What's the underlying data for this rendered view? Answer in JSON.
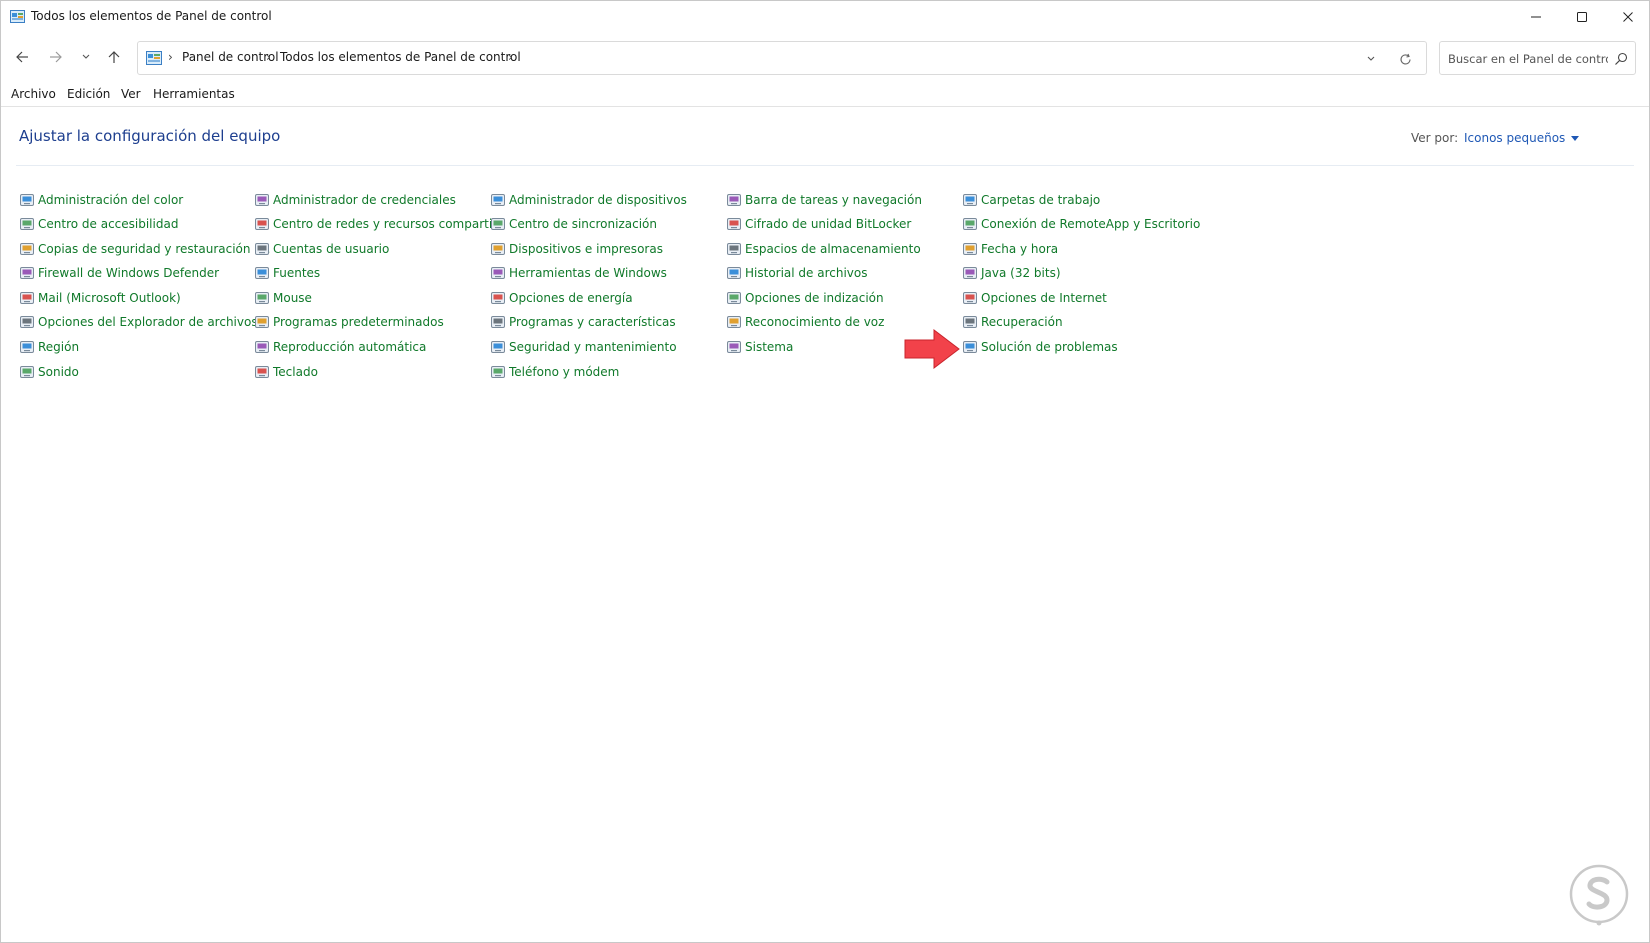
{
  "window": {
    "title": "Todos los elementos de Panel de control",
    "controls": {
      "minimize": "minimize-icon",
      "maximize": "maximize-icon",
      "close": "close-icon"
    }
  },
  "nav": {
    "back": "arrow-left-icon",
    "forward": "arrow-right-icon",
    "recent": "chevron-down-icon",
    "up": "arrow-up-icon"
  },
  "address": {
    "crumbs": [
      "Panel de control",
      "Todos los elementos de Panel de control"
    ],
    "separator": "›"
  },
  "search": {
    "placeholder": "Buscar en el Panel de control"
  },
  "menu": {
    "items": [
      "Archivo",
      "Edición",
      "Ver",
      "Herramientas"
    ]
  },
  "header": {
    "title": "Ajustar la configuración del equipo",
    "view_by_label": "Ver por:",
    "view_by_value": "Iconos pequeños"
  },
  "colors": {
    "link_green": "#10792a",
    "title_blue": "#1e3f8f",
    "accent_blue": "#1f58b5",
    "arrow_red": "#f2424a"
  },
  "columns": [
    [
      {
        "label": "Administración del color",
        "icon": "monitor-color-icon"
      },
      {
        "label": "Centro de accesibilidad",
        "icon": "accessibility-icon"
      },
      {
        "label": "Copias de seguridad y restauración (...",
        "icon": "backup-icon"
      },
      {
        "label": "Firewall de Windows Defender",
        "icon": "firewall-icon"
      },
      {
        "label": "Mail (Microsoft Outlook)",
        "icon": "mail-icon"
      },
      {
        "label": "Opciones del Explorador de archivos",
        "icon": "folder-options-icon"
      },
      {
        "label": "Región",
        "icon": "region-icon"
      },
      {
        "label": "Sonido",
        "icon": "speaker-icon"
      }
    ],
    [
      {
        "label": "Administrador de credenciales",
        "icon": "credential-vault-icon"
      },
      {
        "label": "Centro de redes y recursos comparti...",
        "icon": "network-icon"
      },
      {
        "label": "Cuentas de usuario",
        "icon": "users-icon"
      },
      {
        "label": "Fuentes",
        "icon": "fonts-icon"
      },
      {
        "label": "Mouse",
        "icon": "mouse-icon"
      },
      {
        "label": "Programas predeterminados",
        "icon": "default-programs-icon"
      },
      {
        "label": "Reproducción automática",
        "icon": "autoplay-icon"
      },
      {
        "label": "Teclado",
        "icon": "keyboard-icon"
      }
    ],
    [
      {
        "label": "Administrador de dispositivos",
        "icon": "device-manager-icon"
      },
      {
        "label": "Centro de sincronización",
        "icon": "sync-icon"
      },
      {
        "label": "Dispositivos e impresoras",
        "icon": "printer-icon"
      },
      {
        "label": "Herramientas de Windows",
        "icon": "windows-tools-icon"
      },
      {
        "label": "Opciones de energía",
        "icon": "power-icon"
      },
      {
        "label": "Programas y características",
        "icon": "programs-icon"
      },
      {
        "label": "Seguridad y mantenimiento",
        "icon": "flag-icon"
      },
      {
        "label": "Teléfono y módem",
        "icon": "phone-modem-icon"
      }
    ],
    [
      {
        "label": "Barra de tareas y navegación",
        "icon": "taskbar-icon"
      },
      {
        "label": "Cifrado de unidad BitLocker",
        "icon": "bitlocker-icon"
      },
      {
        "label": "Espacios de almacenamiento",
        "icon": "storage-icon"
      },
      {
        "label": "Historial de archivos",
        "icon": "file-history-icon"
      },
      {
        "label": "Opciones de indización",
        "icon": "indexing-icon"
      },
      {
        "label": "Reconocimiento de voz",
        "icon": "microphone-icon"
      },
      {
        "label": "Sistema",
        "icon": "system-icon"
      }
    ],
    [
      {
        "label": "Carpetas de trabajo",
        "icon": "work-folders-icon"
      },
      {
        "label": "Conexión de RemoteApp y Escritorio",
        "icon": "remoteapp-icon"
      },
      {
        "label": "Fecha y hora",
        "icon": "clock-icon"
      },
      {
        "label": "Java (32 bits)",
        "icon": "java-icon"
      },
      {
        "label": "Opciones de Internet",
        "icon": "internet-options-icon"
      },
      {
        "label": "Recuperación",
        "icon": "recovery-icon"
      },
      {
        "label": "Solución de problemas",
        "icon": "troubleshooting-icon"
      }
    ]
  ]
}
